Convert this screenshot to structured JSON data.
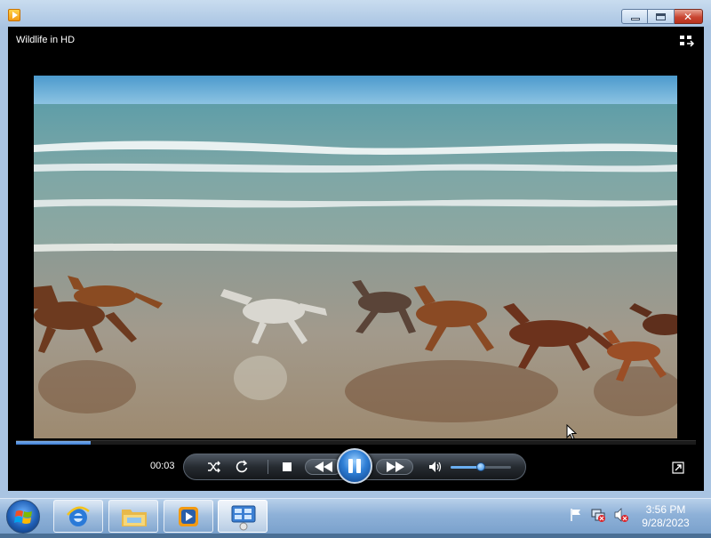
{
  "window": {
    "app_icon": "media-player-icon",
    "caption_buttons": [
      "minimize-icon",
      "maximize-icon",
      "close-icon"
    ]
  },
  "player": {
    "title": "Wildlife in HD",
    "switch_to_library_icon": "switch-to-library-icon",
    "scene": "beach-with-running-horses",
    "time_elapsed": "00:03",
    "seek_progress_fraction": 0.11,
    "volume_fraction": 0.5,
    "controls": [
      {
        "name": "shuffle-icon"
      },
      {
        "name": "repeat-icon"
      },
      {
        "name": "stop-icon"
      },
      {
        "name": "previous-icon"
      },
      {
        "name": "pause-icon"
      },
      {
        "name": "next-icon"
      },
      {
        "name": "volume-icon"
      }
    ],
    "fullscreen_icon": "fullscreen-icon",
    "accent_color": "#3a7bd5"
  },
  "taskbar": {
    "start_icon": "windows-start-icon",
    "pinned": [
      {
        "name": "internet-explorer-icon"
      },
      {
        "name": "file-explorer-icon"
      },
      {
        "name": "windows-media-player-icon"
      },
      {
        "name": "control-panel-icon",
        "active": true
      }
    ],
    "tray": [
      "action-center-flag-icon",
      "network-icon",
      "volume-muted-icon"
    ],
    "clock": {
      "time": "3:56 PM",
      "date": "9/28/2023"
    }
  }
}
